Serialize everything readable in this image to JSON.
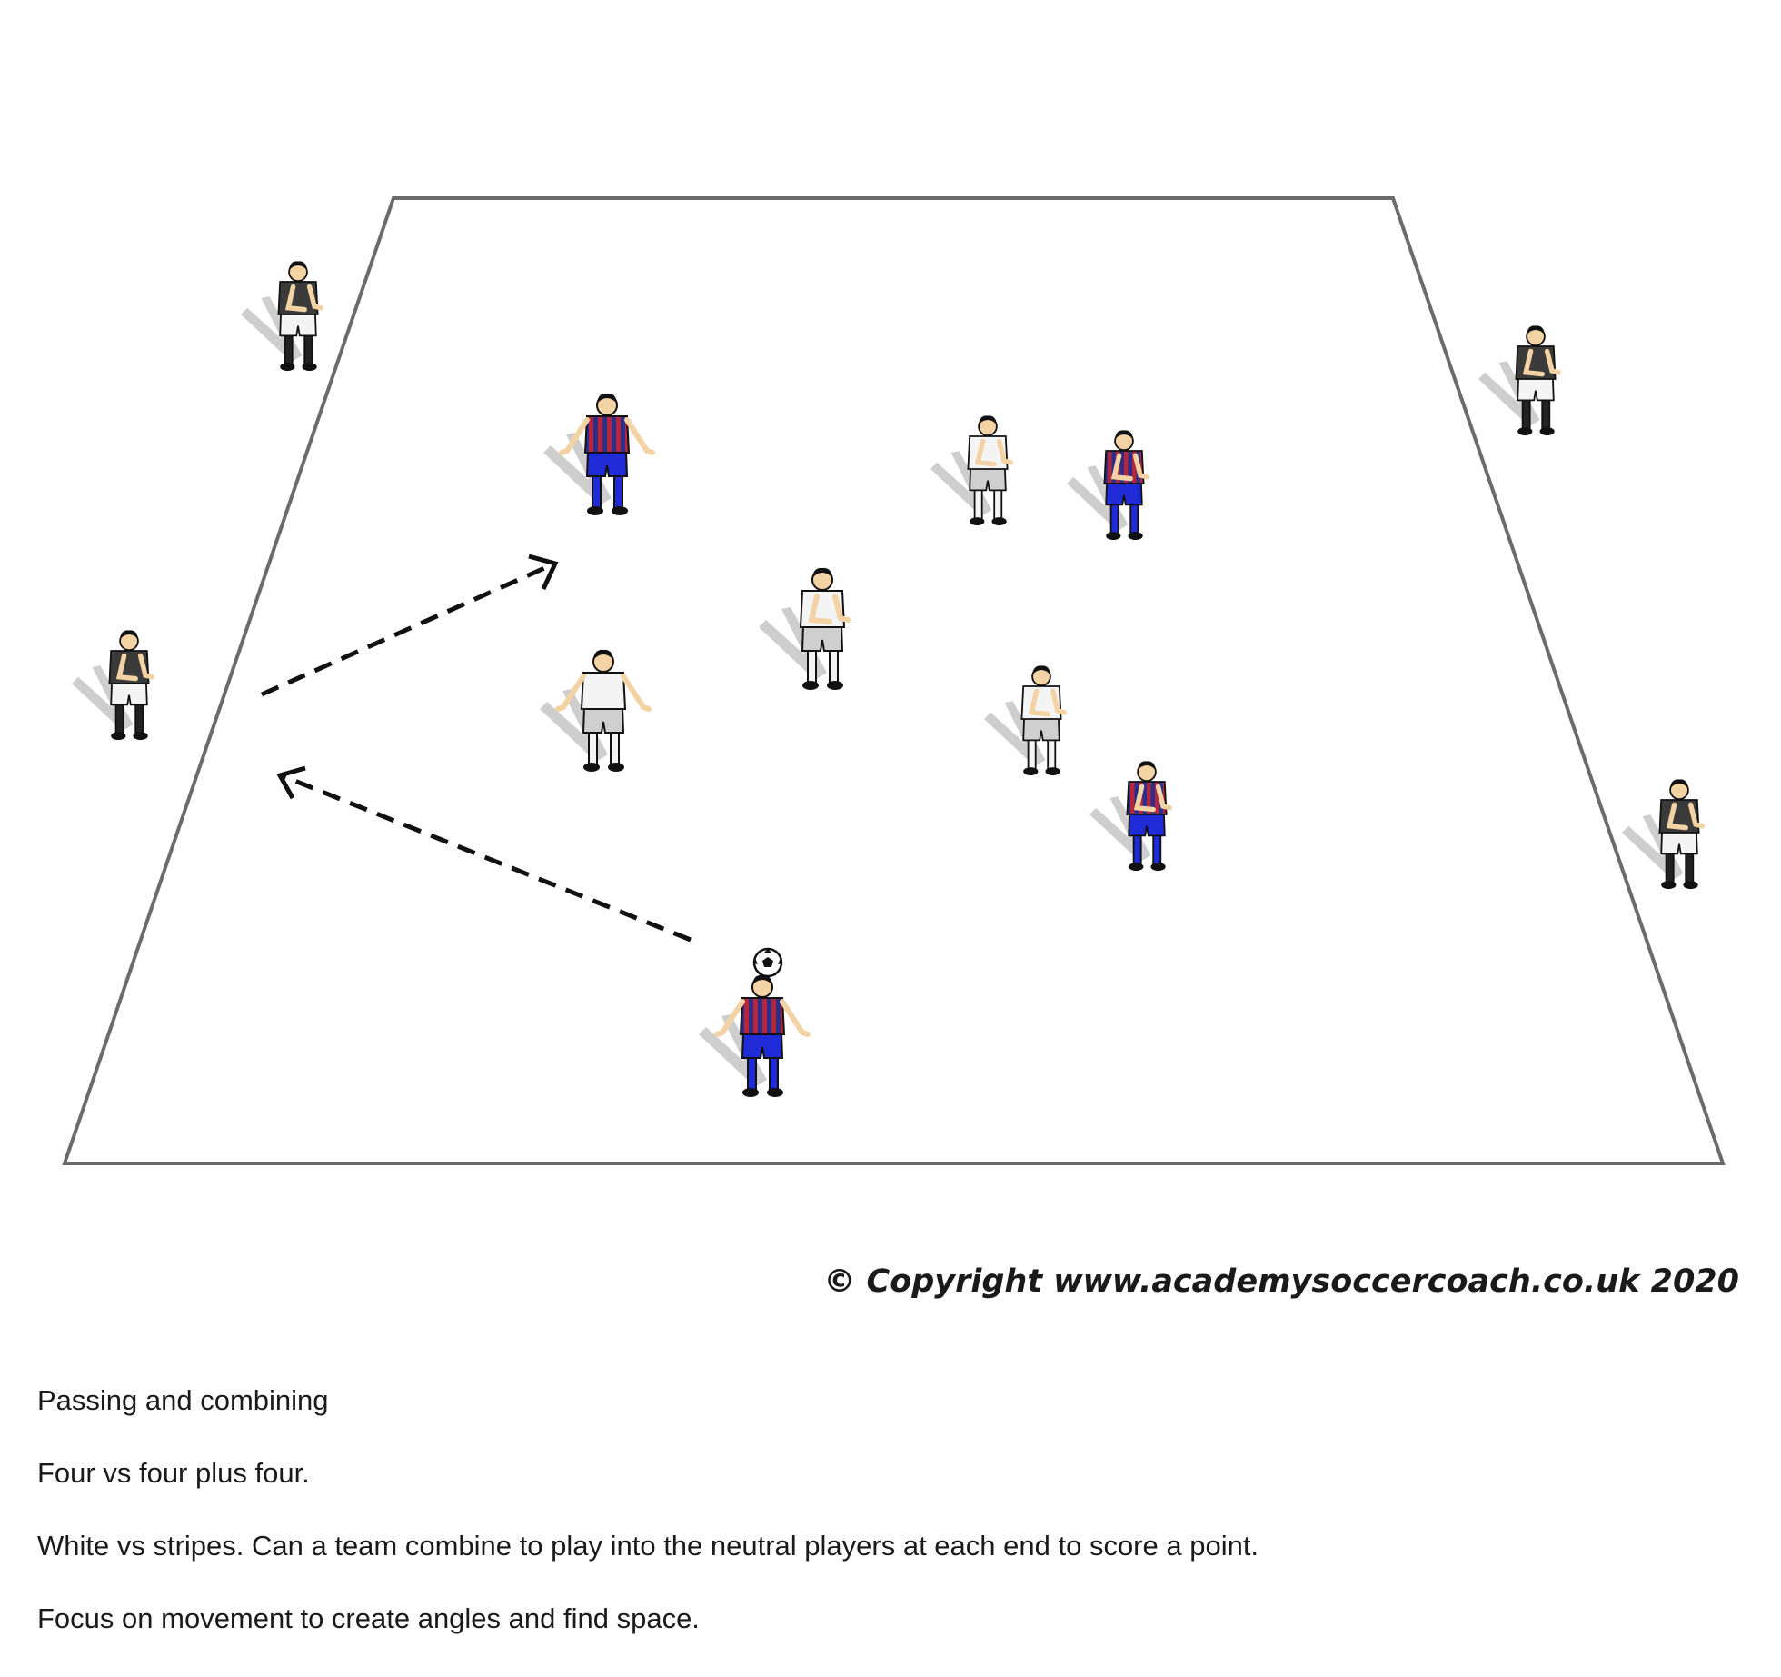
{
  "colors": {
    "pitch_line": "#6b6b6b",
    "arrow": "#111111",
    "stripe_red": "#b5253b",
    "stripe_blue": "#2b2f8a",
    "shorts_blue": "#1f2bd6",
    "white_kit": "#f4f4f4",
    "neutral_shirt": "#3a3a3a",
    "skin": "#f3d3a4",
    "shadow": "#c2c2c2"
  },
  "icons": {
    "ball": "soccer-ball-icon",
    "arrow": "dashed-arrow"
  },
  "teams": {
    "stripes": "stripes",
    "white": "white",
    "neutral": "neutral"
  },
  "copyright": "© Copyright www.academysoccercoach.co.uk 2020",
  "description": [
    "Passing and combining",
    "Four vs four plus four.",
    "White vs stripes. Can a team combine to play into the neutral players at each end to score a point.",
    "Focus on movement to create angles and find space."
  ]
}
